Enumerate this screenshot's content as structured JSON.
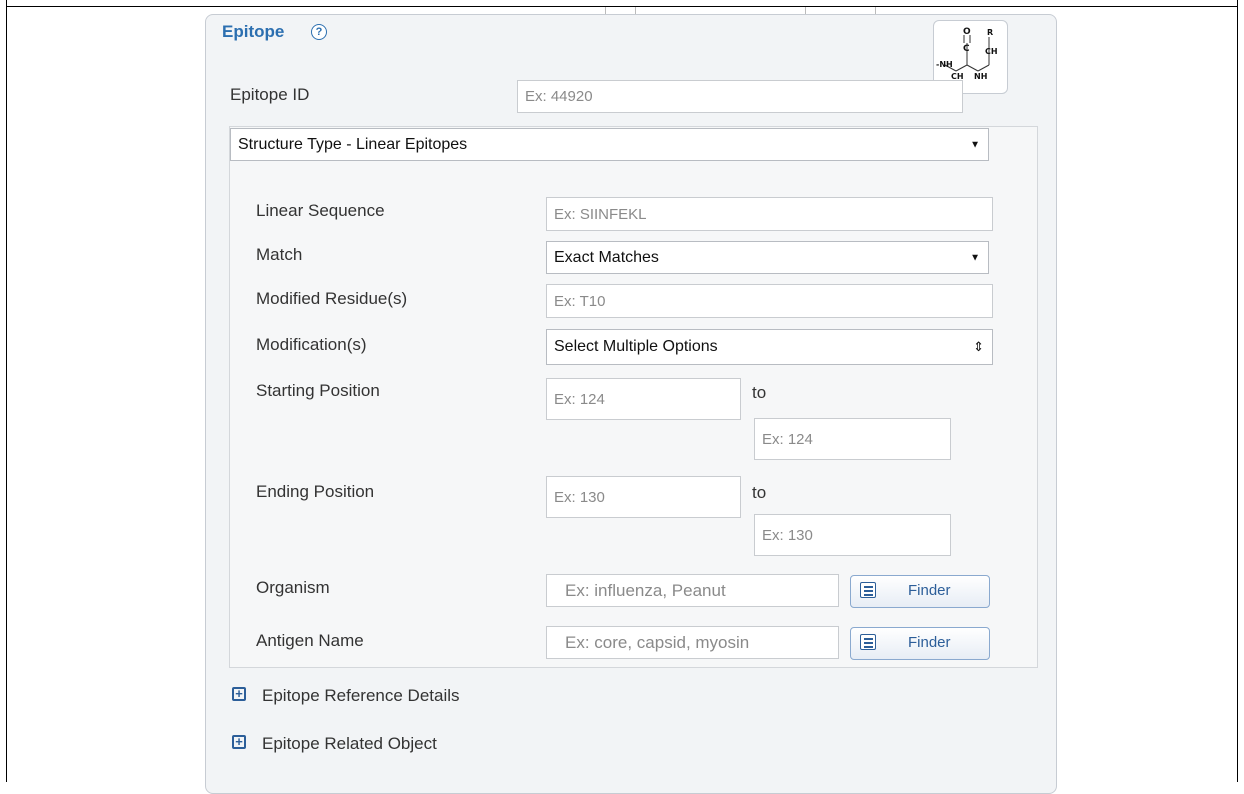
{
  "section": {
    "title": "Epitope",
    "help_symbol": "?"
  },
  "epitope_id": {
    "label": "Epitope ID",
    "placeholder": "Ex: 44920"
  },
  "structure_type": {
    "selected": "Structure Type - Linear Epitopes"
  },
  "linear_sequence": {
    "label": "Linear Sequence",
    "placeholder": "Ex: SIINFEKL"
  },
  "match": {
    "label": "Match",
    "selected": "Exact Matches"
  },
  "modified_residues": {
    "label": "Modified Residue(s)",
    "placeholder": "Ex: T10"
  },
  "modifications": {
    "label": "Modification(s)",
    "selected": "Select Multiple Options"
  },
  "starting_position": {
    "label": "Starting Position",
    "from_placeholder": "Ex: 124",
    "to_label": "to",
    "to_placeholder": "Ex: 124"
  },
  "ending_position": {
    "label": "Ending Position",
    "from_placeholder": "Ex: 130",
    "to_label": "to",
    "to_placeholder": "Ex: 130"
  },
  "organism": {
    "label": "Organism",
    "placeholder": "Ex: influenza, Peanut",
    "finder_label": "Finder"
  },
  "antigen_name": {
    "label": "Antigen Name",
    "placeholder": "Ex: core, capsid, myosin",
    "finder_label": "Finder"
  },
  "expanders": {
    "reference_details": "Epitope Reference Details",
    "related_object": "Epitope Related Object"
  },
  "colors": {
    "accent": "#2c6fb0",
    "panel_bg": "#f2f4f6"
  }
}
